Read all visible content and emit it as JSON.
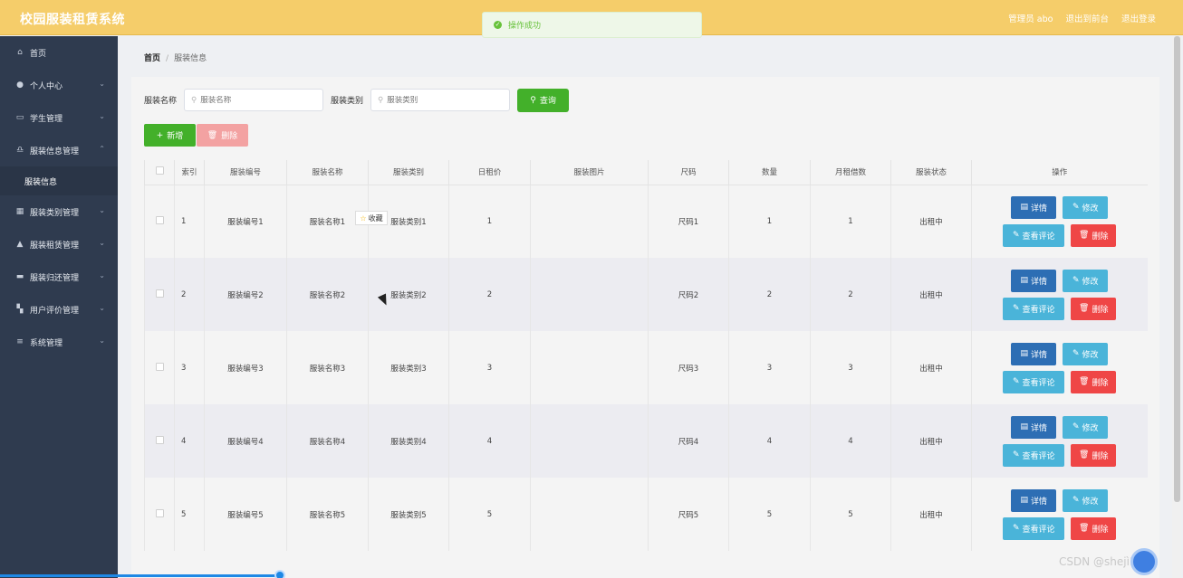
{
  "header": {
    "title": "校园服装租赁系统",
    "admin": "管理员 abo",
    "back_front": "退出到前台",
    "logout": "退出登录"
  },
  "toast": {
    "text": "操作成功"
  },
  "sidebar": {
    "items": [
      {
        "label": "首页",
        "icon": "home-icon"
      },
      {
        "label": "个人中心",
        "icon": "user-icon"
      },
      {
        "label": "学生管理",
        "icon": "id-card-icon"
      },
      {
        "label": "服装信息管理",
        "icon": "bell-icon"
      },
      {
        "label": "服装类别管理",
        "icon": "grid-icon"
      },
      {
        "label": "服装租赁管理",
        "icon": "thumb-up-icon"
      },
      {
        "label": "服装归还管理",
        "icon": "chat-icon"
      },
      {
        "label": "用户评价管理",
        "icon": "apps-icon"
      },
      {
        "label": "系统管理",
        "icon": "menu-icon"
      }
    ],
    "sub_item": "服装信息"
  },
  "breadcrumb": {
    "home": "首页",
    "sep": "/",
    "current": "服装信息"
  },
  "search": {
    "name_label": "服装名称",
    "name_placeholder": "服装名称",
    "category_label": "服装类别",
    "category_placeholder": "服装类别",
    "query_label": "查询"
  },
  "actions": {
    "add_label": "新增",
    "delete_label": "删除"
  },
  "table": {
    "columns": [
      "索引",
      "服装编号",
      "服装名称",
      "服装类别",
      "日租价",
      "服装图片",
      "尺码",
      "数量",
      "月租借数",
      "服装状态",
      "操作"
    ],
    "rows": [
      {
        "index": "1",
        "code": "服装编号1",
        "name": "服装名称1",
        "category": "服装类别1",
        "price": "1",
        "size": "尺码1",
        "qty": "1",
        "monthly": "1",
        "status": "出租中"
      },
      {
        "index": "2",
        "code": "服装编号2",
        "name": "服装名称2",
        "category": "服装类别2",
        "price": "2",
        "size": "尺码2",
        "qty": "2",
        "monthly": "2",
        "status": "出租中"
      },
      {
        "index": "3",
        "code": "服装编号3",
        "name": "服装名称3",
        "category": "服装类别3",
        "price": "3",
        "size": "尺码3",
        "qty": "3",
        "monthly": "3",
        "status": "出租中"
      },
      {
        "index": "4",
        "code": "服装编号4",
        "name": "服装名称4",
        "category": "服装类别4",
        "price": "4",
        "size": "尺码4",
        "qty": "4",
        "monthly": "4",
        "status": "出租中"
      },
      {
        "index": "5",
        "code": "服装编号5",
        "name": "服装名称5",
        "category": "服装类别5",
        "price": "5",
        "size": "尺码5",
        "qty": "5",
        "monthly": "5",
        "status": "出租中"
      }
    ],
    "row_actions": {
      "detail": "详情",
      "edit": "修改",
      "review": "查看评论",
      "delete": "删除"
    }
  },
  "popup": {
    "favorite": "收藏"
  },
  "watermark": "CSDN @shejì1011",
  "colors": {
    "topbar": "#f5cd6a",
    "sidebar": "#2f3b4f",
    "primary_green": "#43b02a",
    "danger": "#ef4646",
    "info": "#4ab4d9",
    "detail_blue": "#2d6eb4"
  }
}
